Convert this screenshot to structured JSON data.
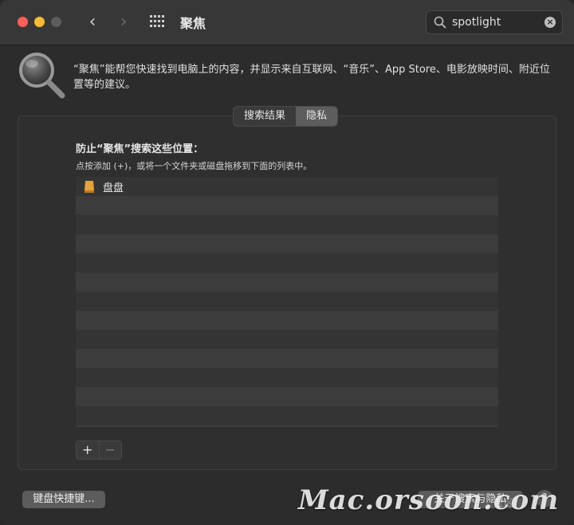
{
  "window": {
    "title": "聚焦"
  },
  "search": {
    "value": "spotlight"
  },
  "header": {
    "description": "“聚焦”能帮您快速找到电脑上的内容，并显示来自互联网、“音乐”、App Store、电影放映时间、附近位置等的建议。"
  },
  "tabs": [
    {
      "label": "搜索结果",
      "active": false
    },
    {
      "label": "隐私",
      "active": true
    }
  ],
  "privacy": {
    "title": "防止“聚焦”搜索这些位置：",
    "hint": "点按添加 (+)，或将一个文件夹或磁盘拖移到下面的列表中。",
    "items": [
      {
        "label": "盘盘",
        "icon": "disk-icon"
      }
    ],
    "add_label": "+",
    "remove_label": "−"
  },
  "footer": {
    "keyboard_button": "键盘快捷键...",
    "about_button": "关于搜索与隐私",
    "help_label": "?"
  },
  "watermark": {
    "text": "Mac.orsoon.com",
    "small_text": "社区"
  },
  "colors": {
    "close": "#ff5f57",
    "minimize": "#febc2e",
    "disk": "#e8a23a"
  }
}
